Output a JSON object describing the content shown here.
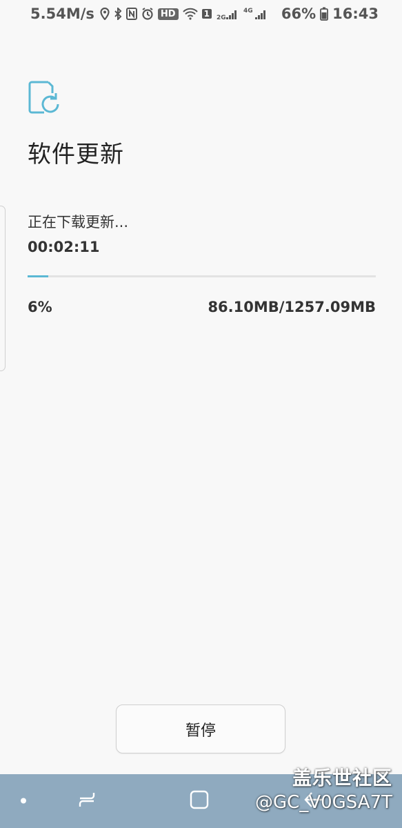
{
  "status_bar": {
    "net_speed": "5.54M/s",
    "hd_label": "HD",
    "sim_label": "1",
    "net_2g": "2G",
    "net_4g": "4G",
    "battery": "66%",
    "time": "16:43"
  },
  "page": {
    "title": "软件更新",
    "status_text": "正在下载更新...",
    "elapsed": "00:02:11",
    "progress_percent_label": "6%",
    "progress_fraction": 0.06,
    "size_text": "86.10MB/1257.09MB",
    "pause_label": "暂停"
  },
  "colors": {
    "accent": "#5bb8d4",
    "navbar": "#8faabf",
    "background": "#f8f8f8"
  },
  "icons": {
    "header": "software-update-icon",
    "nav": [
      "dot-icon",
      "recent-apps-icon",
      "home-icon",
      "back-icon"
    ]
  },
  "watermark": {
    "line1": "盖乐世社区",
    "line2": "@GC_V0GSA7T"
  }
}
